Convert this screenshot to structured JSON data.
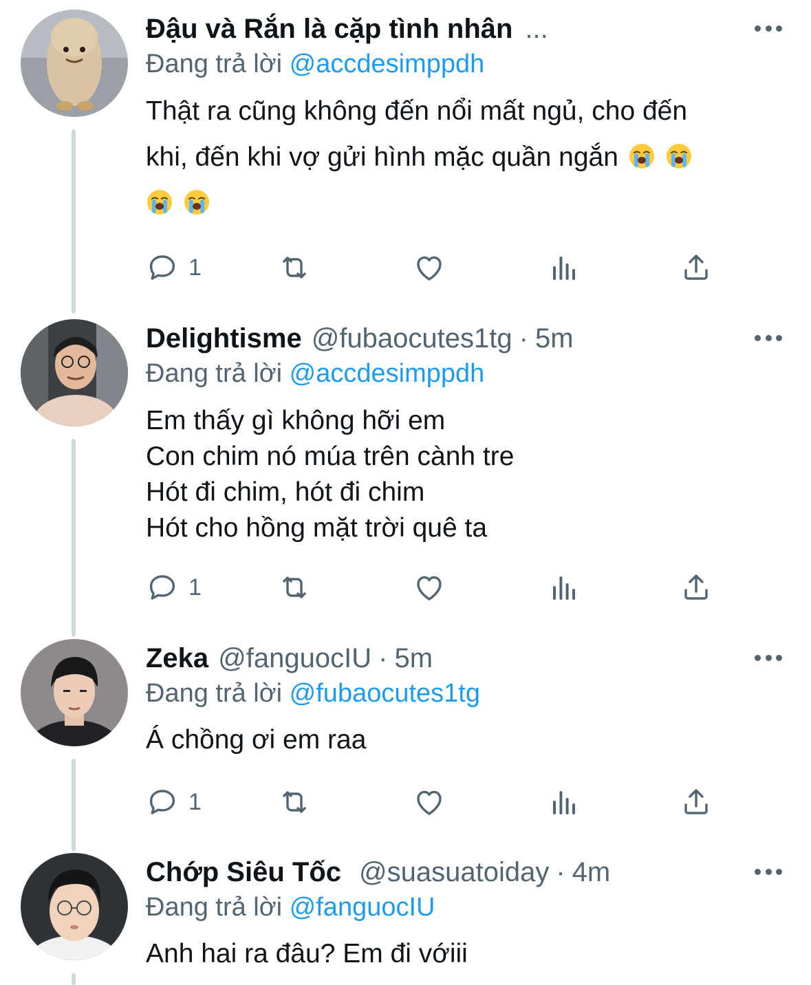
{
  "colors": {
    "text": "#0f1419",
    "secondary": "#536471",
    "mention": "#1d9bf0",
    "thread": "#cfd9de"
  },
  "icons": [
    "reply-icon",
    "retweet-icon",
    "like-icon",
    "analytics-icon",
    "share-icon",
    "more-icon",
    "loudly-crying-face-emoji"
  ],
  "tweets": [
    {
      "name": "Đậu và Rắn là cặp tình nhân",
      "name_ellipsis": "...",
      "reply_prefix": "Đang trả lời",
      "reply_to": "@accdesimppdh",
      "text_lines": [
        "Thật ra cũng không đến nổi mất ngủ, cho đến",
        "khi, đến khi vợ gửi hình mặc quần ngắn"
      ],
      "emoji_count_line2": 2,
      "emoji_count_line3": 2,
      "reply_count": "1"
    },
    {
      "name": "Delightisme",
      "handle": "@fubaocutes1tg",
      "separator": "·",
      "time": "5m",
      "reply_prefix": "Đang trả lời",
      "reply_to": "@accdesimppdh",
      "text_lines": [
        "Em thấy gì không hỡi em",
        "Con chim nó múa trên cành tre",
        "Hót đi chim, hót đi chim",
        "Hót cho hồng mặt trời quê ta"
      ],
      "reply_count": "1"
    },
    {
      "name": "Zeka",
      "handle": "@fanguocIU",
      "separator": "·",
      "time": "5m",
      "reply_prefix": "Đang trả lời",
      "reply_to": "@fubaocutes1tg",
      "text_lines": [
        "Á chồng ơi em raa"
      ],
      "reply_count": "1"
    },
    {
      "name": "Chớp Siêu Tốc",
      "handle": "@suasuatoiday",
      "separator": "·",
      "time": "4m",
      "reply_prefix": "Đang trả lời",
      "reply_to": "@fanguocIU",
      "text_lines": [
        "Anh hai ra đâu? Em đi vớiii"
      ]
    }
  ]
}
